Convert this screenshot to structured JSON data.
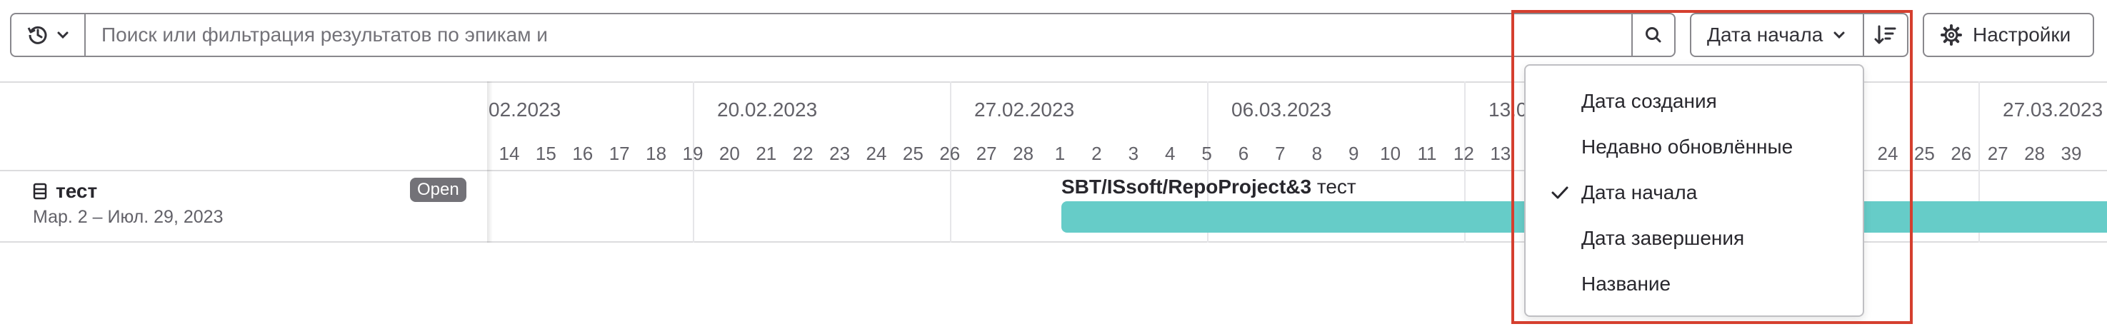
{
  "filter_bar": {
    "search_placeholder": "Поиск или фильтрация результатов по эпикам и",
    "sort_selected": "Дата начала",
    "settings_label": "Настройки"
  },
  "timeline": {
    "weeks": [
      "02.2023",
      "20.02.2023",
      "27.02.2023",
      "06.03.2023",
      "13.0",
      "27.03.2023"
    ],
    "days": [
      "14",
      "15",
      "16",
      "17",
      "18",
      "19",
      "20",
      "21",
      "22",
      "23",
      "24",
      "25",
      "26",
      "27",
      "28",
      "1",
      "2",
      "3",
      "4",
      "5",
      "6",
      "7",
      "8",
      "9",
      "10",
      "11",
      "12",
      "13",
      "14",
      "24",
      "25",
      "26",
      "27",
      "28",
      "39"
    ]
  },
  "epic": {
    "title": "тест",
    "dates": "Мар. 2 – Июл. 29, 2023",
    "status": "Open",
    "ref_path": "SBT/ISsoft/RepoProject&3",
    "ref_title": "тест"
  },
  "sort_menu": {
    "items": [
      {
        "label": "Дата создания",
        "checked": false
      },
      {
        "label": "Недавно обновлённые",
        "checked": false
      },
      {
        "label": "Дата начала",
        "checked": true
      },
      {
        "label": "Дата завершения",
        "checked": false
      },
      {
        "label": "Название",
        "checked": false
      }
    ]
  },
  "colors": {
    "epic_bar": "#66ccc8",
    "status_badge": "#737278",
    "highlight": "#d53f2f"
  }
}
